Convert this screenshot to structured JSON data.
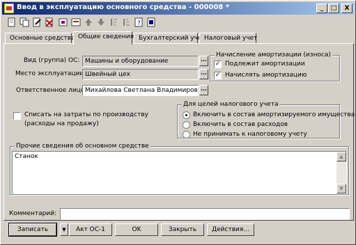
{
  "window": {
    "title": "Ввод в эксплуатацию основного средства - 000008 *",
    "minimize_glyph": "_",
    "maximize_glyph": "□",
    "close_glyph": "X"
  },
  "toolbar": {
    "tools": [
      "new-icon",
      "copy-icon",
      "edit-icon",
      "delete-icon",
      "mark-icon",
      "post-icon",
      "move-up-icon",
      "move-down-icon",
      "sort-asc-icon",
      "sort-desc-icon",
      "help-icon",
      "info-icon"
    ]
  },
  "tabs": [
    {
      "label": "Основные средства",
      "active": false
    },
    {
      "label": "Общие сведения",
      "active": true
    },
    {
      "label": "Бухгалтерский учет",
      "active": false
    },
    {
      "label": "Налоговый учет",
      "active": false
    }
  ],
  "form": {
    "os_group_label": "Вид (группа) ОС:",
    "os_group_value": "Машины и оборудование",
    "location_label": "Место эксплуатации:",
    "location_value": "Швейный цех",
    "responsible_label": "Ответственное лицо:",
    "responsible_value": "Михайлова Светлана Владимировна",
    "select_glyph": "...",
    "writeoff_line1": "Списать на затраты по производству",
    "writeoff_line2": "(расходы на продажу)",
    "writeoff_checked": false
  },
  "amortization": {
    "title": "Начисление амортизации (износа)",
    "items": [
      {
        "label": "Подлежит амортизации",
        "checked": true
      },
      {
        "label": "Начислять амортизацию",
        "checked": true
      }
    ],
    "check_glyph": "✓"
  },
  "tax": {
    "title": "Для целей налогового учета",
    "options": [
      {
        "label": "Включить в состав амортизируемого имущества",
        "selected": true
      },
      {
        "label": "Включить в состав расходов",
        "selected": false
      },
      {
        "label": "Не принимать к налоговому учету",
        "selected": false
      }
    ]
  },
  "other_info": {
    "title": "Прочие сведения об основном средстве",
    "value": "Станок",
    "scroll_up": "▲",
    "scroll_down": "▼"
  },
  "comment": {
    "label": "Комментарий:",
    "value": ""
  },
  "buttons": {
    "record": "Записать",
    "dropdown": "▼",
    "act": "Акт ОС-1",
    "ok": "OK",
    "close": "Закрыть",
    "actions": "Действия..."
  }
}
